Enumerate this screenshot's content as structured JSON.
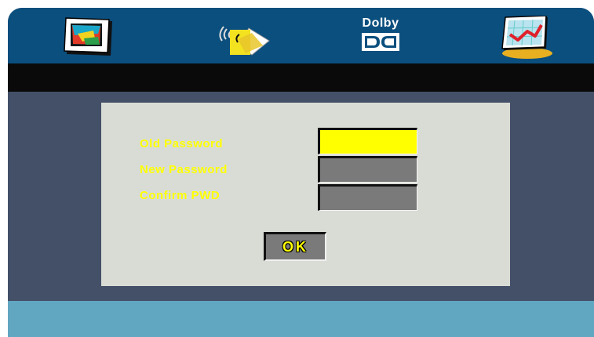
{
  "menu": {
    "icons": [
      {
        "name": "picture-settings-icon"
      },
      {
        "name": "audio-settings-icon"
      },
      {
        "name": "dolby-icon",
        "label": "Dolby"
      },
      {
        "name": "setup-icon"
      }
    ]
  },
  "dialog": {
    "old_password_label": "Old Password",
    "new_password_label": "New Password",
    "confirm_label": "Confirm PWD",
    "ok_label": "OK"
  },
  "colors": {
    "top_bar": "#0b4f7e",
    "black_bar": "#0a0a0a",
    "background": "#445068",
    "bottom_bar": "#62a7c2",
    "dialog": "#d8dcd5",
    "highlight": "#ffff00",
    "field": "#7a7a7a"
  }
}
